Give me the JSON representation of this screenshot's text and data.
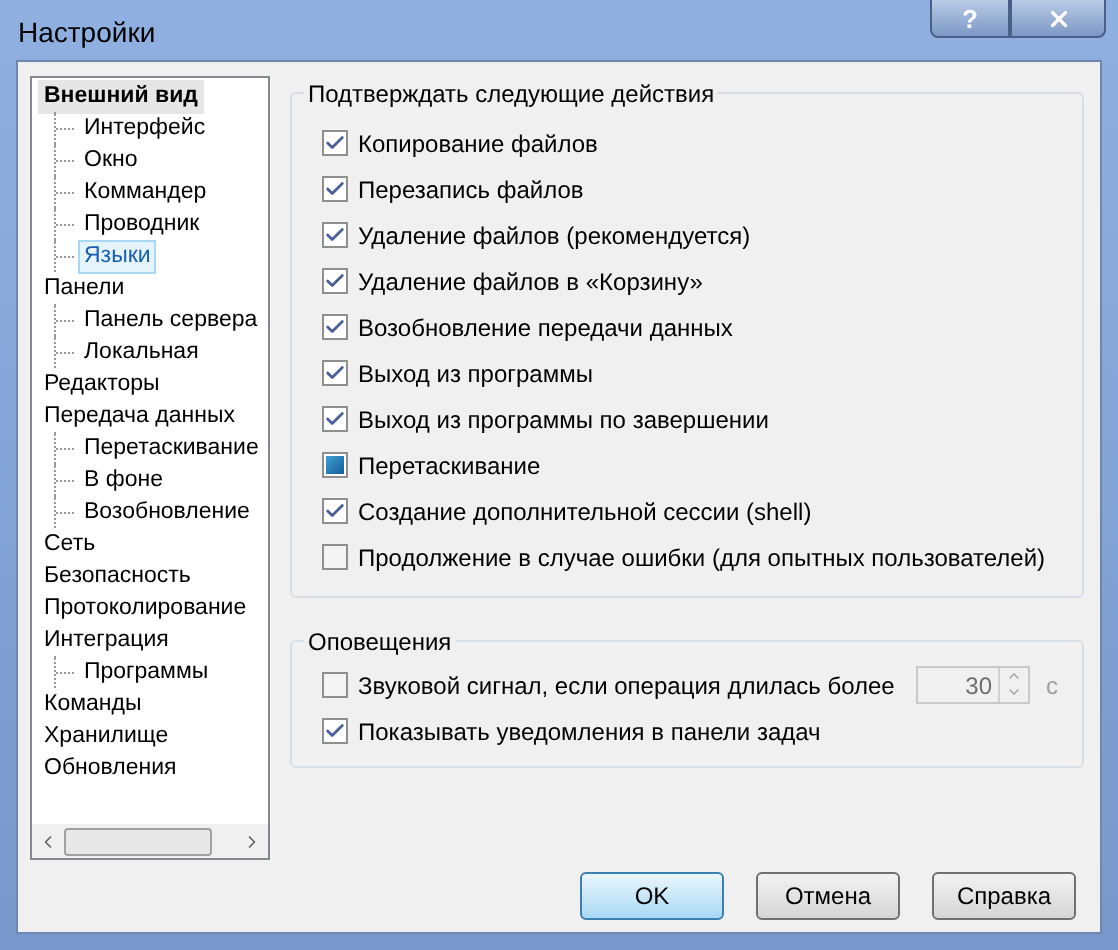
{
  "window": {
    "title": "Настройки",
    "help_button": "?"
  },
  "tree": [
    {
      "label": "Внешний вид",
      "active": true,
      "selected": false,
      "children": [
        {
          "label": "Интерфейс",
          "selected": false
        },
        {
          "label": "Окно",
          "selected": false
        },
        {
          "label": "Коммандер",
          "selected": false
        },
        {
          "label": "Проводник",
          "selected": false
        },
        {
          "label": "Языки",
          "selected": true
        }
      ]
    },
    {
      "label": "Панели",
      "active": false,
      "selected": false,
      "children": [
        {
          "label": "Панель сервера",
          "selected": false
        },
        {
          "label": "Локальная",
          "selected": false
        }
      ]
    },
    {
      "label": "Редакторы",
      "active": false,
      "selected": false
    },
    {
      "label": "Передача данных",
      "active": false,
      "selected": false,
      "children": [
        {
          "label": "Перетаскивание",
          "selected": false
        },
        {
          "label": "В фоне",
          "selected": false
        },
        {
          "label": "Возобновление",
          "selected": false
        }
      ]
    },
    {
      "label": "Сеть",
      "active": false,
      "selected": false
    },
    {
      "label": "Безопасность",
      "active": false,
      "selected": false
    },
    {
      "label": "Протоколирование",
      "active": false,
      "selected": false
    },
    {
      "label": "Интеграция",
      "active": false,
      "selected": false,
      "children": [
        {
          "label": "Программы",
          "selected": false
        }
      ]
    },
    {
      "label": "Команды",
      "active": false,
      "selected": false
    },
    {
      "label": "Хранилище",
      "active": false,
      "selected": false
    },
    {
      "label": "Обновления",
      "active": false,
      "selected": false
    }
  ],
  "confirm_group": {
    "title": "Подтверждать следующие действия",
    "items": [
      {
        "label": "Копирование файлов",
        "checked": true,
        "indeterminate": false
      },
      {
        "label": "Перезапись файлов",
        "checked": true,
        "indeterminate": false
      },
      {
        "label": "Удаление файлов (рекомендуется)",
        "checked": true,
        "indeterminate": false
      },
      {
        "label": "Удаление файлов в «Корзину»",
        "checked": true,
        "indeterminate": false
      },
      {
        "label": "Возобновление передачи данных",
        "checked": true,
        "indeterminate": false
      },
      {
        "label": "Выход из программы",
        "checked": true,
        "indeterminate": false
      },
      {
        "label": "Выход из программы по завершении",
        "checked": true,
        "indeterminate": false
      },
      {
        "label": "Перетаскивание",
        "checked": false,
        "indeterminate": true
      },
      {
        "label": "Создание дополнительной сессии (shell)",
        "checked": true,
        "indeterminate": false
      },
      {
        "label": "Продолжение в случае ошибки (для опытных пользователей)",
        "checked": false,
        "indeterminate": false
      }
    ]
  },
  "notify_group": {
    "title": "Оповещения",
    "beep": {
      "label": "Звуковой сигнал, если операция длилась более",
      "checked": false,
      "indeterminate": false,
      "value": "30",
      "disabled": true,
      "unit": "с"
    },
    "taskbar": {
      "label": "Показывать уведомления в панели задач",
      "checked": true,
      "indeterminate": false
    }
  },
  "buttons": [
    {
      "label": "OK",
      "default": true
    },
    {
      "label": "Отмена",
      "default": false
    },
    {
      "label": "Справка",
      "default": false
    }
  ]
}
